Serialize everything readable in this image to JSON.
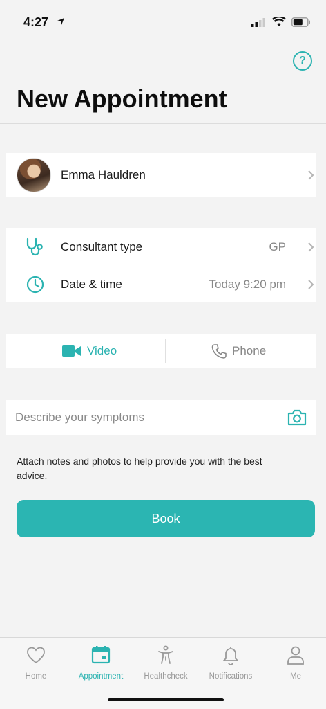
{
  "status": {
    "time": "4:27"
  },
  "header": {
    "title": "New Appointment"
  },
  "patient": {
    "name": "Emma Hauldren"
  },
  "details": {
    "consultant": {
      "label": "Consultant type",
      "value": "GP"
    },
    "datetime": {
      "label": "Date & time",
      "value": "Today 9:20 pm"
    }
  },
  "mode": {
    "video_label": "Video",
    "phone_label": "Phone",
    "selected": "Video"
  },
  "symptoms": {
    "placeholder": "Describe your symptoms",
    "value": ""
  },
  "helper": {
    "text": "Attach notes and photos to help provide you with the best advice."
  },
  "book": {
    "label": "Book"
  },
  "tabs": [
    {
      "label": "Home",
      "icon": "heart-icon"
    },
    {
      "label": "Appointment",
      "icon": "calendar-icon"
    },
    {
      "label": "Healthcheck",
      "icon": "body-icon"
    },
    {
      "label": "Notifications",
      "icon": "bell-icon"
    },
    {
      "label": "Me",
      "icon": "person-icon"
    }
  ],
  "colors": {
    "accent": "#2bb3b1",
    "background": "#f3f3f3",
    "muted": "#888888"
  }
}
